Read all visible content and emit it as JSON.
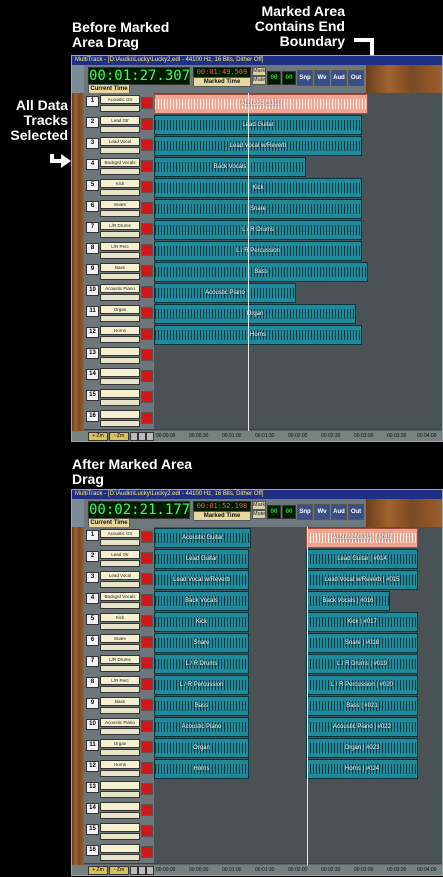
{
  "captions": {
    "before": "Before Marked Area Drag",
    "end_boundary": "Marked Area Contains End Boundary",
    "all_selected": "All Data Tracks Selected",
    "after": "After Marked Area Drag"
  },
  "windows": {
    "before": {
      "title": "MultiTrack - [D:\\Audio\\Lucky\\Lucky2.edl - 44100 Hz, 16 Bits, Dither Off]",
      "time": "00:01:27.307",
      "small_time": "00:01:49.569",
      "marked_label": "Marked Time",
      "current_label": "Current Time"
    },
    "after": {
      "title": "MultiTrack - [D:\\Audio\\Lucky\\Lucky2.edl - 44100 Hz, 16 Bits, Dither Off]",
      "time": "00:02:21.177",
      "small_time": "00:01:52.198",
      "marked_label": "Marked Time",
      "current_label": "Current Time"
    }
  },
  "toolbar": {
    "buttons": [
      "Snp",
      "Wv",
      "Aud",
      "Out"
    ],
    "mode_labels": [
      "Mark",
      "Mute",
      "Sol",
      "Auto"
    ]
  },
  "tracks": [
    {
      "num": "1",
      "name": "Acoustic Gtr"
    },
    {
      "num": "2",
      "name": "Lead Gtr"
    },
    {
      "num": "3",
      "name": "Lead Vocal"
    },
    {
      "num": "4",
      "name": "Backgrd Vocals"
    },
    {
      "num": "5",
      "name": "Kick"
    },
    {
      "num": "6",
      "name": "Snare"
    },
    {
      "num": "7",
      "name": "L/R Drums"
    },
    {
      "num": "8",
      "name": "L/R Perc"
    },
    {
      "num": "9",
      "name": "Bass"
    },
    {
      "num": "10",
      "name": "Acoustic Piano"
    },
    {
      "num": "11",
      "name": "Organ"
    },
    {
      "num": "12",
      "name": "Horns"
    },
    {
      "num": "13",
      "name": ""
    },
    {
      "num": "14",
      "name": ""
    },
    {
      "num": "15",
      "name": ""
    },
    {
      "num": "16",
      "name": ""
    }
  ],
  "clips_before": [
    "Acoustic Guitar",
    "Lead Guitar",
    "Lead Vocal w/Reverb",
    "Back Vocals",
    "Kick",
    "Snare",
    "L / R Drums",
    "L / R Percussion",
    "Bass",
    "Acoustic Piano",
    "Organ",
    "Horns"
  ],
  "clips_after_left": [
    "Acoustic Guitar",
    "Lead Guitar",
    "Lead Vocal w/Reverb",
    "Back Vocals",
    "Kick",
    "Snare",
    "L / R Drums",
    "L / R Percussion",
    "Bass",
    "Acoustic Piano",
    "Organ",
    "Horns"
  ],
  "clips_after_right": [
    "Acoustic Guitar | #013",
    "Lead Guitar | #014",
    "Lead Vocal w/Reverb | #015",
    "Back Vocals | #016",
    "Kick | #017",
    "Snare | #018",
    "L / R Drums | #019",
    "L / R Percussion | #020",
    "Bass | #021",
    "Acoustic Piano | #022",
    "Organ | #023",
    "Horns | #024"
  ],
  "ruler": {
    "zoom_in": "+ Zm",
    "zoom_out": "- Zm",
    "ticks": [
      "00:00:00",
      "00:00:30",
      "00:01:00",
      "00:01:30",
      "00:02:00",
      "00:02:30",
      "00:03:00",
      "00:03:30",
      "00:04:00"
    ]
  }
}
